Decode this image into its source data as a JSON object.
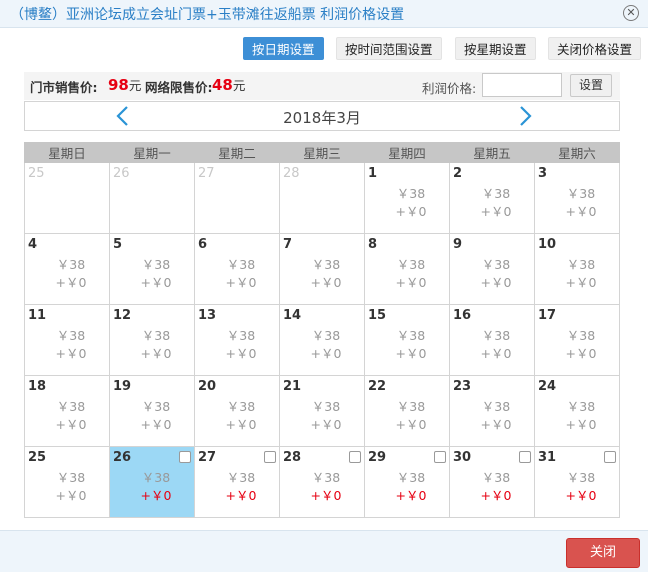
{
  "window": {
    "title": "（博鳌）亚洲论坛成立会址门票+玉带滩往返船票 利润价格设置",
    "close_icon": "close-circle-icon"
  },
  "modes": [
    {
      "label": "按日期设置",
      "active": true
    },
    {
      "label": "按时间范围设置",
      "active": false
    },
    {
      "label": "按星期设置",
      "active": false
    },
    {
      "label": "关闭价格设置",
      "active": false
    }
  ],
  "prices": {
    "door_label": "门市销售价:",
    "door_value": "98",
    "unit": "元",
    "net_label": "网络限售价:",
    "net_value": "48",
    "profit_label": "利润价格:",
    "profit_value": "",
    "set_button": "设置"
  },
  "calendar": {
    "month_label": "2018年3月",
    "prev_icon": "chevron-left-icon",
    "next_icon": "chevron-right-icon",
    "weekdays": [
      "星期日",
      "星期一",
      "星期二",
      "星期三",
      "星期四",
      "星期五",
      "星期六"
    ],
    "rows": [
      [
        {
          "day": "25",
          "muted": true
        },
        {
          "day": "26",
          "muted": true
        },
        {
          "day": "27",
          "muted": true
        },
        {
          "day": "28",
          "muted": true
        },
        {
          "day": "1",
          "price": "￥38",
          "profit": "+￥0"
        },
        {
          "day": "2",
          "price": "￥38",
          "profit": "+￥0"
        },
        {
          "day": "3",
          "price": "￥38",
          "profit": "+￥0"
        }
      ],
      [
        {
          "day": "4",
          "price": "￥38",
          "profit": "+￥0"
        },
        {
          "day": "5",
          "price": "￥38",
          "profit": "+￥0"
        },
        {
          "day": "6",
          "price": "￥38",
          "profit": "+￥0"
        },
        {
          "day": "7",
          "price": "￥38",
          "profit": "+￥0"
        },
        {
          "day": "8",
          "price": "￥38",
          "profit": "+￥0"
        },
        {
          "day": "9",
          "price": "￥38",
          "profit": "+￥0"
        },
        {
          "day": "10",
          "price": "￥38",
          "profit": "+￥0"
        }
      ],
      [
        {
          "day": "11",
          "price": "￥38",
          "profit": "+￥0"
        },
        {
          "day": "12",
          "price": "￥38",
          "profit": "+￥0"
        },
        {
          "day": "13",
          "price": "￥38",
          "profit": "+￥0"
        },
        {
          "day": "14",
          "price": "￥38",
          "profit": "+￥0"
        },
        {
          "day": "15",
          "price": "￥38",
          "profit": "+￥0"
        },
        {
          "day": "16",
          "price": "￥38",
          "profit": "+￥0"
        },
        {
          "day": "17",
          "price": "￥38",
          "profit": "+￥0"
        }
      ],
      [
        {
          "day": "18",
          "price": "￥38",
          "profit": "+￥0"
        },
        {
          "day": "19",
          "price": "￥38",
          "profit": "+￥0"
        },
        {
          "day": "20",
          "price": "￥38",
          "profit": "+￥0"
        },
        {
          "day": "21",
          "price": "￥38",
          "profit": "+￥0"
        },
        {
          "day": "22",
          "price": "￥38",
          "profit": "+￥0"
        },
        {
          "day": "23",
          "price": "￥38",
          "profit": "+￥0"
        },
        {
          "day": "24",
          "price": "￥38",
          "profit": "+￥0"
        }
      ],
      [
        {
          "day": "25",
          "price": "￥38",
          "profit": "+￥0"
        },
        {
          "day": "26",
          "price": "￥38",
          "profit": "+￥0",
          "selected": true,
          "checkbox": true,
          "profit_red": true
        },
        {
          "day": "27",
          "price": "￥38",
          "profit": "+￥0",
          "checkbox": true,
          "profit_red": true
        },
        {
          "day": "28",
          "price": "￥38",
          "profit": "+￥0",
          "checkbox": true,
          "profit_red": true
        },
        {
          "day": "29",
          "price": "￥38",
          "profit": "+￥0",
          "checkbox": true,
          "profit_red": true
        },
        {
          "day": "30",
          "price": "￥38",
          "profit": "+￥0",
          "checkbox": true,
          "profit_red": true
        },
        {
          "day": "31",
          "price": "￥38",
          "profit": "+￥0",
          "checkbox": true,
          "profit_red": true
        }
      ]
    ]
  },
  "footer": {
    "close_label": "关闭"
  },
  "colors": {
    "title": "#2a7fc6",
    "active_mode": "#3d8fd6",
    "price_red": "#e60012",
    "selected_cell": "#9cd8f5",
    "close_button": "#d9534f"
  }
}
